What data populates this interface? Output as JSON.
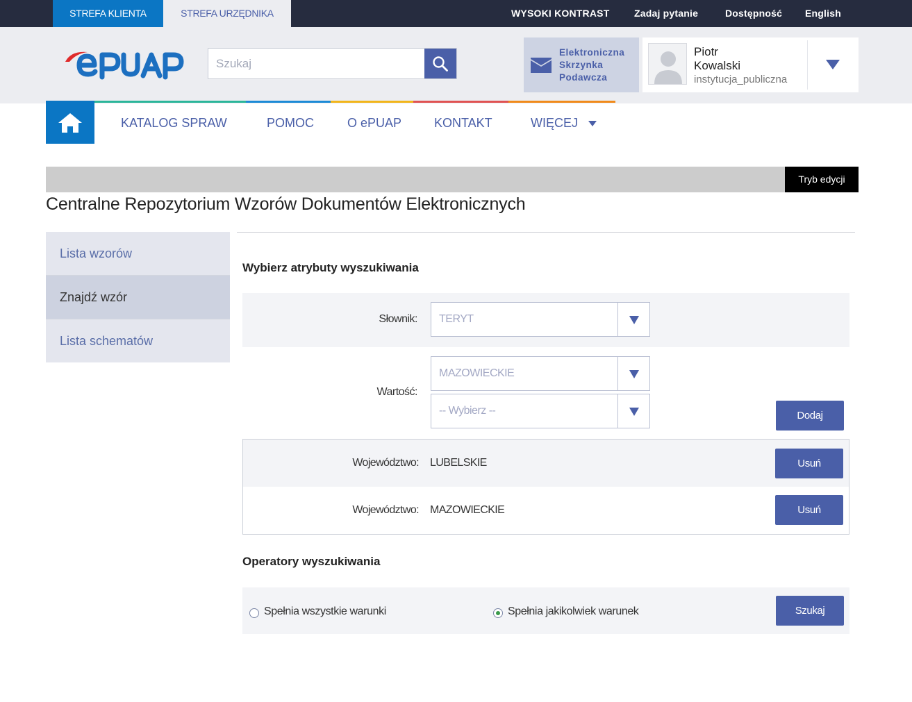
{
  "topbar": {
    "zone_client": "STREFA KLIENTA",
    "zone_official": "STREFA URZĘDNIKA",
    "high_contrast": "WYSOKI KONTRAST",
    "ask_question": "Zadaj pytanie",
    "accessibility": "Dostępność",
    "language": "English"
  },
  "header": {
    "search_placeholder": "Szukaj",
    "inbox_line1": "Elektroniczna",
    "inbox_line2": "Skrzynka",
    "inbox_line3": "Podawcza",
    "user_first_name": "Piotr",
    "user_last_name": "Kowalski",
    "user_role": "instytucja_publiczna"
  },
  "nav": {
    "items": [
      "KATALOG SPRAW",
      "POMOC",
      "O ePUAP",
      "KONTAKT",
      "WIĘCEJ"
    ],
    "stripe_colors": [
      "#2bb59a",
      "#1c8ad6",
      "#f2b51b",
      "#e05252",
      "#f08a1b"
    ]
  },
  "page": {
    "edit_mode": "Tryb edycji",
    "title": "Centralne Repozytorium Wzorów Dokumentów Elektronicznych"
  },
  "sidebar": {
    "items": [
      {
        "label": "Lista wzorów"
      },
      {
        "label": "Znajdź wzór"
      },
      {
        "label": "Lista schematów"
      }
    ]
  },
  "search_attrs": {
    "heading": "Wybierz atrybuty wyszukiwania",
    "dictionary_label": "Słownik:",
    "dictionary_value": "TERYT",
    "value_label": "Wartość:",
    "value_primary": "MAZOWIECKIE",
    "value_secondary": "-- Wybierz --",
    "add_button": "Dodaj",
    "selected": [
      {
        "key": "Województwo:",
        "value": "LUBELSKIE",
        "remove": "Usuń"
      },
      {
        "key": "Województwo:",
        "value": "MAZOWIECKIE",
        "remove": "Usuń"
      }
    ]
  },
  "operators": {
    "heading": "Operatory wyszukiwania",
    "option_all": "Spełnia wszystkie warunki",
    "option_any": "Spełnia jakikolwiek warunek",
    "selected": "any",
    "search_button": "Szukaj"
  },
  "colors": {
    "topbar": "#262c3f",
    "brand_blue": "#0b76c4",
    "accent": "#4a5fa8",
    "logo_red": "#e02b2b"
  }
}
